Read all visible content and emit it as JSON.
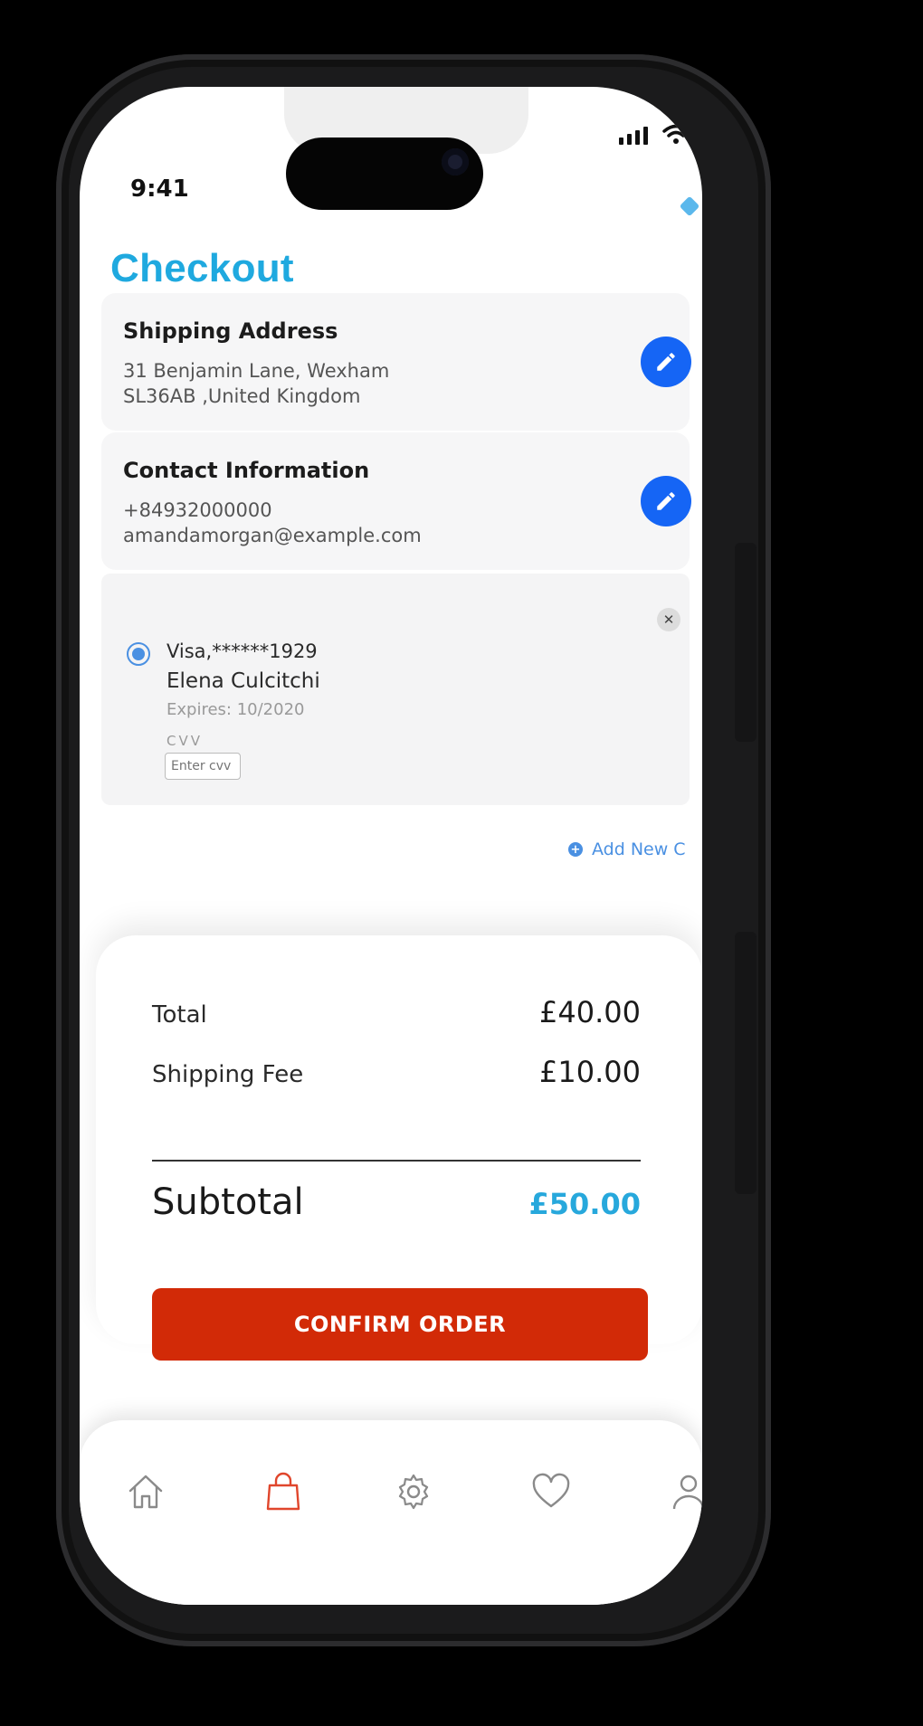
{
  "status_bar": {
    "time": "9:41"
  },
  "page": {
    "title": "Checkout"
  },
  "shipping": {
    "title": "Shipping Address",
    "line1": "31 Benjamin Lane, Wexham",
    "line2": "SL36AB ,United Kingdom",
    "edit_icon": "pencil-icon"
  },
  "contact": {
    "title": "Contact Information",
    "phone": "+84932000000",
    "email": "amandamorgan@example.com",
    "edit_icon": "pencil-icon"
  },
  "payment": {
    "card": "Visa,******1929",
    "holder": "Elena Culcitchi",
    "expires": "Expires: 10/2020",
    "cvv_label": "CVV",
    "cvv_placeholder": "Enter cvv",
    "remove_icon": "close-icon",
    "add_new_label": "Add New C"
  },
  "summary": {
    "total_label": "Total",
    "total_value": "£40.00",
    "shipping_label": "Shipping Fee",
    "shipping_value": "£10.00",
    "subtotal_label": "Subtotal",
    "subtotal_value": "£50.00",
    "confirm_label": "CONFIRM ORDER"
  },
  "tabs": [
    {
      "icon": "home-icon",
      "active": false
    },
    {
      "icon": "shopping-bag-icon",
      "active": true
    },
    {
      "icon": "gear-icon",
      "active": false
    },
    {
      "icon": "heart-icon",
      "active": false
    },
    {
      "icon": "profile-icon",
      "active": false
    }
  ],
  "colors": {
    "accent": "#1fa9df",
    "edit_button": "#1565f5",
    "confirm_button": "#d22a07",
    "link": "#4a90e2",
    "active_tab": "#e0462c"
  }
}
